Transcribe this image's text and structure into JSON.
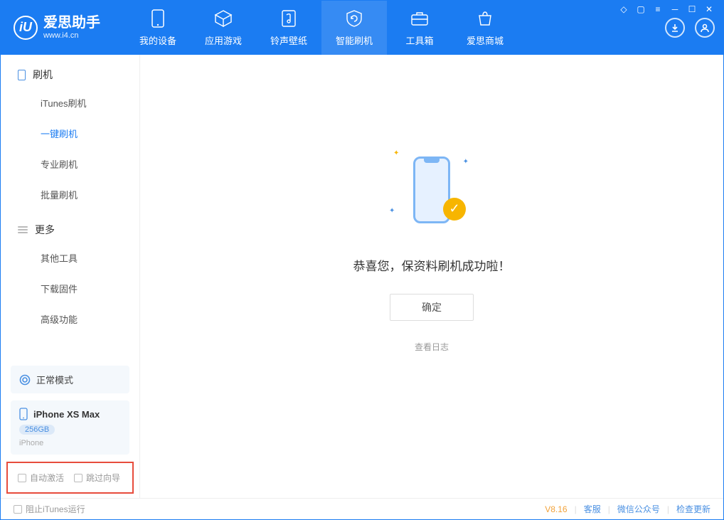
{
  "app": {
    "logo_glyph": "iU",
    "name": "爱思助手",
    "url": "www.i4.cn"
  },
  "nav": {
    "items": [
      {
        "label": "我的设备"
      },
      {
        "label": "应用游戏"
      },
      {
        "label": "铃声壁纸"
      },
      {
        "label": "智能刷机"
      },
      {
        "label": "工具箱"
      },
      {
        "label": "爱思商城"
      }
    ]
  },
  "sidebar": {
    "section1": {
      "title": "刷机"
    },
    "items1": [
      {
        "label": "iTunes刷机"
      },
      {
        "label": "一键刷机"
      },
      {
        "label": "专业刷机"
      },
      {
        "label": "批量刷机"
      }
    ],
    "section2": {
      "title": "更多"
    },
    "items2": [
      {
        "label": "其他工具"
      },
      {
        "label": "下载固件"
      },
      {
        "label": "高级功能"
      }
    ],
    "mode": "正常模式",
    "device": {
      "name": "iPhone XS Max",
      "capacity": "256GB",
      "type": "iPhone"
    },
    "checkboxes": {
      "auto_activate": "自动激活",
      "skip_guide": "跳过向导"
    }
  },
  "main": {
    "message": "恭喜您，保资料刷机成功啦！",
    "ok": "确定",
    "view_log": "查看日志"
  },
  "footer": {
    "block_itunes": "阻止iTunes运行",
    "version": "V8.16",
    "links": [
      "客服",
      "微信公众号",
      "检查更新"
    ]
  }
}
